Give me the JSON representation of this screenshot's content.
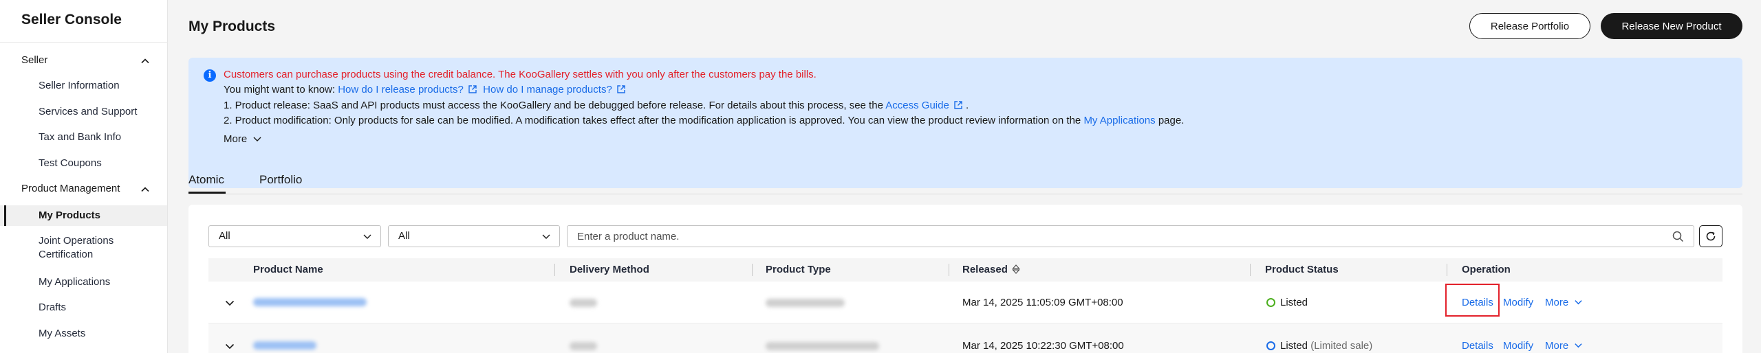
{
  "sidebar": {
    "title": "Seller Console",
    "groups": [
      {
        "label": "Seller",
        "items": [
          "Seller Information",
          "Services and Support",
          "Tax and Bank Info",
          "Test Coupons"
        ]
      },
      {
        "label": "Product Management",
        "items": [
          "My Products",
          "Joint Operations Certification",
          "My Applications",
          "Drafts",
          "My Assets"
        ]
      }
    ],
    "joint_line1": "Joint Operations",
    "joint_line2": "Certification",
    "active_item": "My Products"
  },
  "header": {
    "title": "My Products",
    "release_portfolio_label": "Release Portfolio",
    "release_new_product_label": "Release New Product"
  },
  "notice": {
    "warning": "Customers can purchase products using the credit balance. The KooGallery settles with you only after the customers pay the bills.",
    "know_prefix": "You might want to know:",
    "link_release": "How do I release products?",
    "link_manage": "How do I manage products?",
    "line1_text": "1. Product release: SaaS and API products must access the KooGallery and be debugged before release. For details about this process, see the",
    "line1_link": "Access Guide",
    "line1_end": ".",
    "line2_text": "2. Product modification: Only products for sale can be modified. A modification takes effect after the modification application is approved. You can view the product review information on the",
    "line2_link": "My Applications",
    "line2_end": "page.",
    "more_label": "More"
  },
  "tabs": [
    {
      "label": "Atomic",
      "active": true
    },
    {
      "label": "Portfolio",
      "active": false
    }
  ],
  "filters": {
    "select1_value": "All",
    "select2_value": "All",
    "search_placeholder": "Enter a product name."
  },
  "table": {
    "columns": [
      "Product Name",
      "Delivery Method",
      "Product Type",
      "Released",
      "Product Status",
      "Operation"
    ],
    "rows": [
      {
        "released": "Mar 14, 2025 11:05:09 GMT+08:00",
        "status": "Listed",
        "status_note": "",
        "status_color": "#4caf1e",
        "ops": [
          "Details",
          "Modify",
          "More"
        ]
      },
      {
        "released": "Mar 14, 2025 10:22:30 GMT+08:00",
        "status": "Listed",
        "status_note": "(Limited sale)",
        "status_color": "#1a6ce8",
        "ops": [
          "Details",
          "Modify",
          "More"
        ]
      }
    ]
  },
  "colors": {
    "accent": "#1a6ce8",
    "warning": "#e3212b",
    "notice_bg": "#d9e9ff",
    "primary_button": "#191919"
  }
}
